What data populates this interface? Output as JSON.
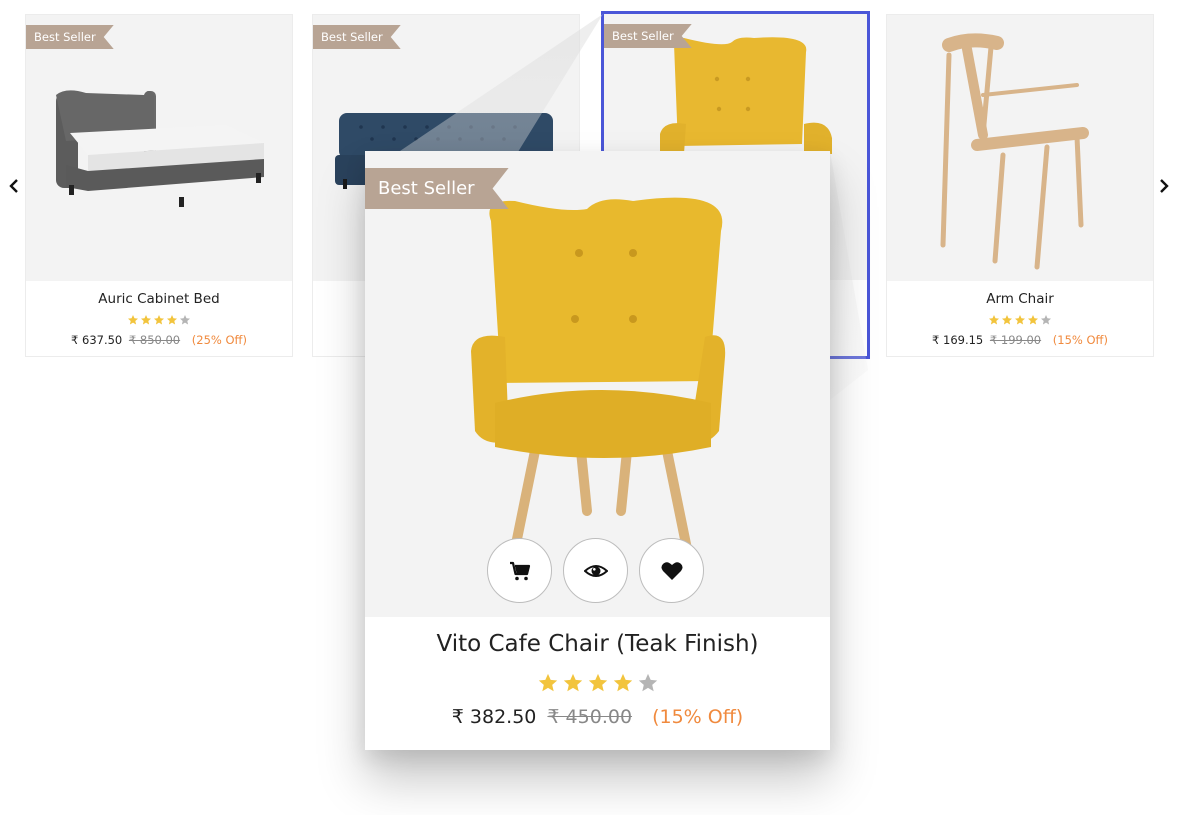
{
  "carousel": {
    "prev_icon": "chevron-left-icon",
    "next_icon": "chevron-right-icon"
  },
  "products": [
    {
      "badge": "Best Seller",
      "name": "Auric Cabinet Bed",
      "rating": 4,
      "rating_max": 5,
      "price": "₹ 637.50",
      "old_price": "₹ 850.00",
      "discount": "(25% Off)",
      "image": "bed"
    },
    {
      "badge": "Best Seller",
      "name": "",
      "rating": 4,
      "rating_max": 5,
      "price": "",
      "old_price": "",
      "discount": "",
      "image": "sofa"
    },
    {
      "badge": "Best Seller",
      "name": "",
      "rating": 4,
      "rating_max": 5,
      "price": "",
      "old_price": "",
      "discount": "",
      "image": "yellow-armchair",
      "selected": true
    },
    {
      "badge": "",
      "name": "Arm Chair",
      "rating": 4,
      "rating_max": 5,
      "price": "₹ 169.15",
      "old_price": "₹ 199.00",
      "discount": "(15% Off)",
      "image": "wooden-arm-chair"
    }
  ],
  "zoom": {
    "badge": "Best Seller",
    "name": "Vito Cafe Chair (Teak Finish)",
    "rating": 4,
    "rating_max": 5,
    "price": "₹ 382.50",
    "old_price": "₹ 450.00",
    "discount": "(15% Off)",
    "actions": [
      "cart-icon",
      "eye-icon",
      "heart-icon"
    ]
  },
  "colors": {
    "badge": "#b8a494",
    "star_filled": "#f2c43d",
    "star_empty": "#b5b5b5",
    "discount": "#f08a3e",
    "selection": "#4a56d8",
    "image_bg": "#f3f3f3"
  }
}
